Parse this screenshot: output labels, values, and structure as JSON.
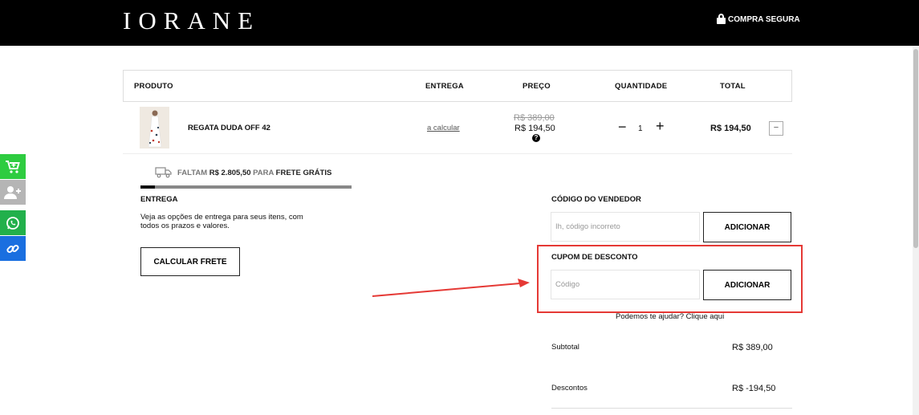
{
  "header": {
    "logo": "IORANE",
    "secure_label": "COMPRA SEGURA"
  },
  "table": {
    "headers": {
      "produto": "PRODUTO",
      "entrega": "ENTREGA",
      "preco": "PREÇO",
      "quantidade": "QUANTIDADE",
      "total": "TOTAL"
    },
    "item": {
      "name": "REGATA DUDA OFF 42",
      "shipping_link": "a calcular",
      "old_price": "R$ 389,00",
      "price": "R$ 194,50",
      "help_glyph": "?",
      "qty_minus": "−",
      "quantity": "1",
      "qty_plus": "+",
      "total": "R$ 194,50",
      "remove_glyph": "−"
    }
  },
  "free_shipping": {
    "prefix": "FALTAM",
    "amount": "R$ 2.805,50",
    "middle": "PARA",
    "suffix": "FRETE GRÁTIS",
    "progress_fraction": 0.07
  },
  "entrega": {
    "title": "ENTREGA",
    "description": "Veja as opções de entrega para seus itens, com todos os prazos e valores.",
    "button": "CALCULAR FRETE"
  },
  "vendedor": {
    "title": "CÓDIGO DO VENDEDOR",
    "placeholder": "Ih, código  incorreto",
    "button": "ADICIONAR"
  },
  "cupom": {
    "title": "CUPOM DE DESCONTO",
    "placeholder": "Código",
    "button": "ADICIONAR"
  },
  "help_link": "Podemos te ajudar? Clique aqui",
  "summary": {
    "subtotal_label": "Subtotal",
    "subtotal_value": "R$ 389,00",
    "discount_label": "Descontos",
    "discount_value": "R$ -194,50"
  },
  "side_buttons": [
    "cart-icon",
    "add-user-icon",
    "whatsapp-icon",
    "link-icon"
  ],
  "colors": {
    "header_bg": "#000000",
    "highlight": "#e53935",
    "cart_green": "#2ecc40",
    "whatsapp_green": "#22b04b",
    "link_blue": "#1a6fe0"
  }
}
